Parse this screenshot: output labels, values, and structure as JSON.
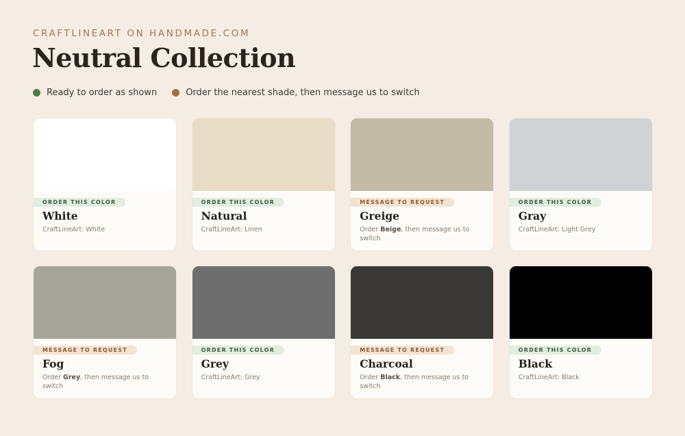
{
  "header": {
    "eyebrow": "CRAFTLINEART ON HANDMADE.COM",
    "title": "Neutral Collection"
  },
  "legend": [
    {
      "label": "Ready to order as shown",
      "color": "#4b7a45"
    },
    {
      "label": "Order the nearest shade, then message us to switch",
      "color": "#a46f44"
    }
  ],
  "cards": [
    {
      "swatch": "#ffffff",
      "status": "order",
      "badge": "ORDER THIS COLOR",
      "name": "White",
      "sub_pre": "CraftLineArt: White",
      "sub_bold": "",
      "sub_post": ""
    },
    {
      "swatch": "#e9dcc6",
      "status": "order",
      "badge": "ORDER THIS COLOR",
      "name": "Natural",
      "sub_pre": "CraftLineArt: Linen",
      "sub_bold": "",
      "sub_post": ""
    },
    {
      "swatch": "#c3bba7",
      "status": "message",
      "badge": "MESSAGE TO REQUEST",
      "name": "Greige",
      "sub_pre": "Order ",
      "sub_bold": "Beige",
      "sub_post": ", then message us to switch"
    },
    {
      "swatch": "#d0d3d5",
      "status": "order",
      "badge": "ORDER THIS COLOR",
      "name": "Gray",
      "sub_pre": "CraftLineArt: Light Grey",
      "sub_bold": "",
      "sub_post": ""
    },
    {
      "swatch": "#a6a59c",
      "status": "message",
      "badge": "MESSAGE TO REQUEST",
      "name": "Fog",
      "sub_pre": "Order ",
      "sub_bold": "Grey",
      "sub_post": ", then message us to switch"
    },
    {
      "swatch": "#6e6e6e",
      "status": "order",
      "badge": "ORDER THIS COLOR",
      "name": "Grey",
      "sub_pre": "CraftLineArt: Grey",
      "sub_bold": "",
      "sub_post": ""
    },
    {
      "swatch": "#3a3836",
      "status": "message",
      "badge": "MESSAGE TO REQUEST",
      "name": "Charcoal",
      "sub_pre": "Order ",
      "sub_bold": "Black",
      "sub_post": ", then message us to switch"
    },
    {
      "swatch": "#000000",
      "status": "order",
      "badge": "ORDER THIS COLOR",
      "name": "Black",
      "sub_pre": "CraftLineArt: Black",
      "sub_bold": "",
      "sub_post": ""
    }
  ]
}
